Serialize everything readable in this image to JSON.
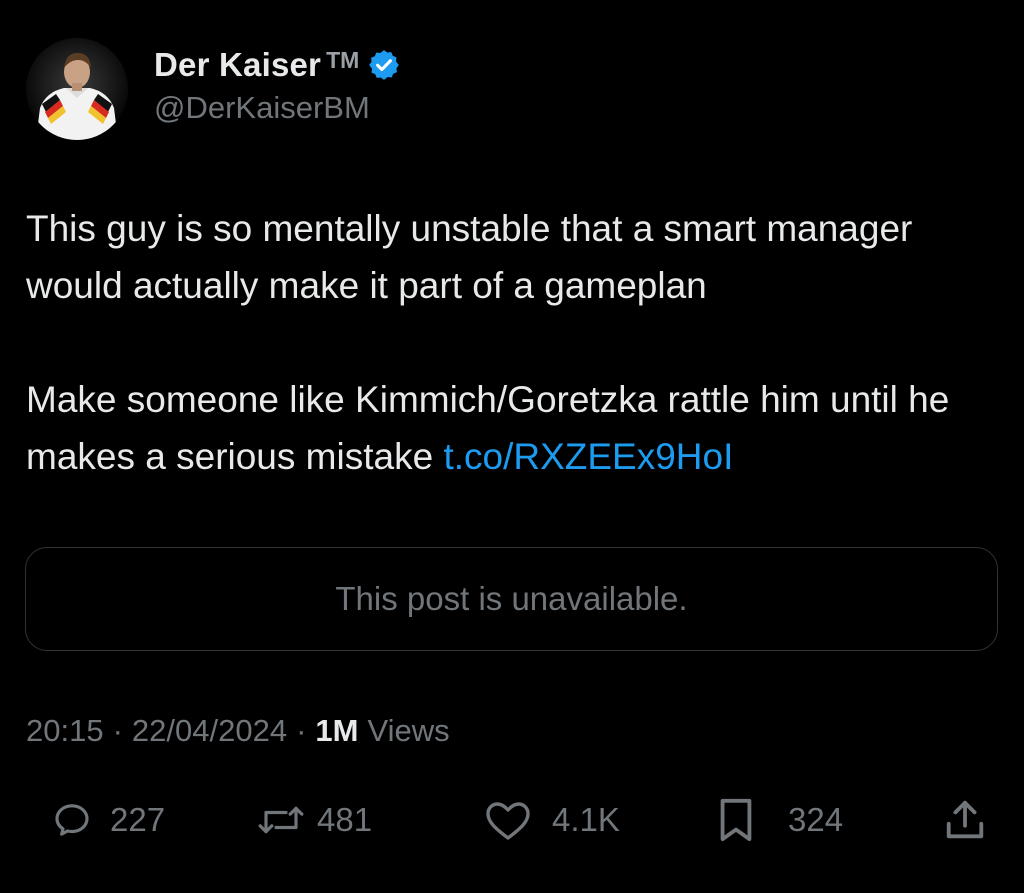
{
  "author": {
    "display_name": "Der Kaiser",
    "tm": "TM",
    "handle": "@DerKaiserBM"
  },
  "post": {
    "paragraph_1": "This guy is so mentally unstable that a smart manager would actually make it part of a gameplan",
    "paragraph_2_text": "Make someone like Kimmich/Goretzka rattle him until he makes a serious mistake ",
    "paragraph_2_link": "t.co/RXZEEx9HoI"
  },
  "quoted_post": {
    "message": "This post is unavailable."
  },
  "meta": {
    "time": "20:15",
    "date": "22/04/2024",
    "views_count": "1M",
    "views_label": "Views"
  },
  "actions": {
    "replies": "227",
    "reposts": "481",
    "likes": "4.1K",
    "bookmarks": "324"
  },
  "colors": {
    "background": "#000000",
    "text": "#e7e9ea",
    "secondary": "#71767b",
    "link": "#1d9bf0",
    "verified": "#1d9bf0",
    "border": "#2f3336"
  },
  "icons": [
    "verified-badge-icon",
    "reply-icon",
    "repost-icon",
    "like-icon",
    "bookmark-icon",
    "share-icon"
  ]
}
